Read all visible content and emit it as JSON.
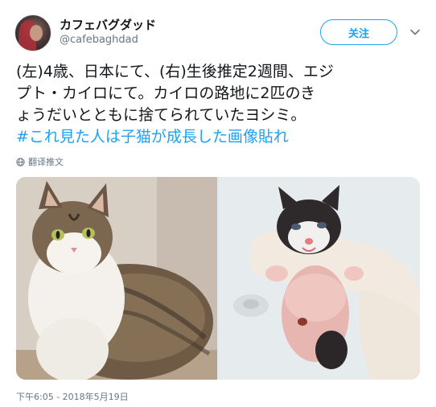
{
  "author": {
    "display_name": "カフェバグダッド",
    "handle": "@cafebaghdad",
    "avatar_icon": "avatar-photo"
  },
  "follow_button": {
    "label": "关注"
  },
  "menu_icon": "chevron-down-icon",
  "tweet": {
    "lines": [
      "(左)4歳、日本にて、(右)生後推定2週間、エジ",
      "プト・カイロにて。カイロの路地に2匹のき",
      "ょうだいとともに捨てられていたヨシミ。"
    ],
    "hashtag": "#これ見た人は子猫が成長した画像貼れ"
  },
  "translate": {
    "label": "翻译推文",
    "icon": "globe-icon"
  },
  "media": {
    "left_photo": "adult-cat-photo",
    "right_photo": "kitten-photo"
  },
  "timestamp": "下午6:05 - 2018年5月19日",
  "colors": {
    "accent": "#1da1f2",
    "text": "#14171a",
    "secondary": "#657786",
    "border": "#e1e8ed"
  }
}
